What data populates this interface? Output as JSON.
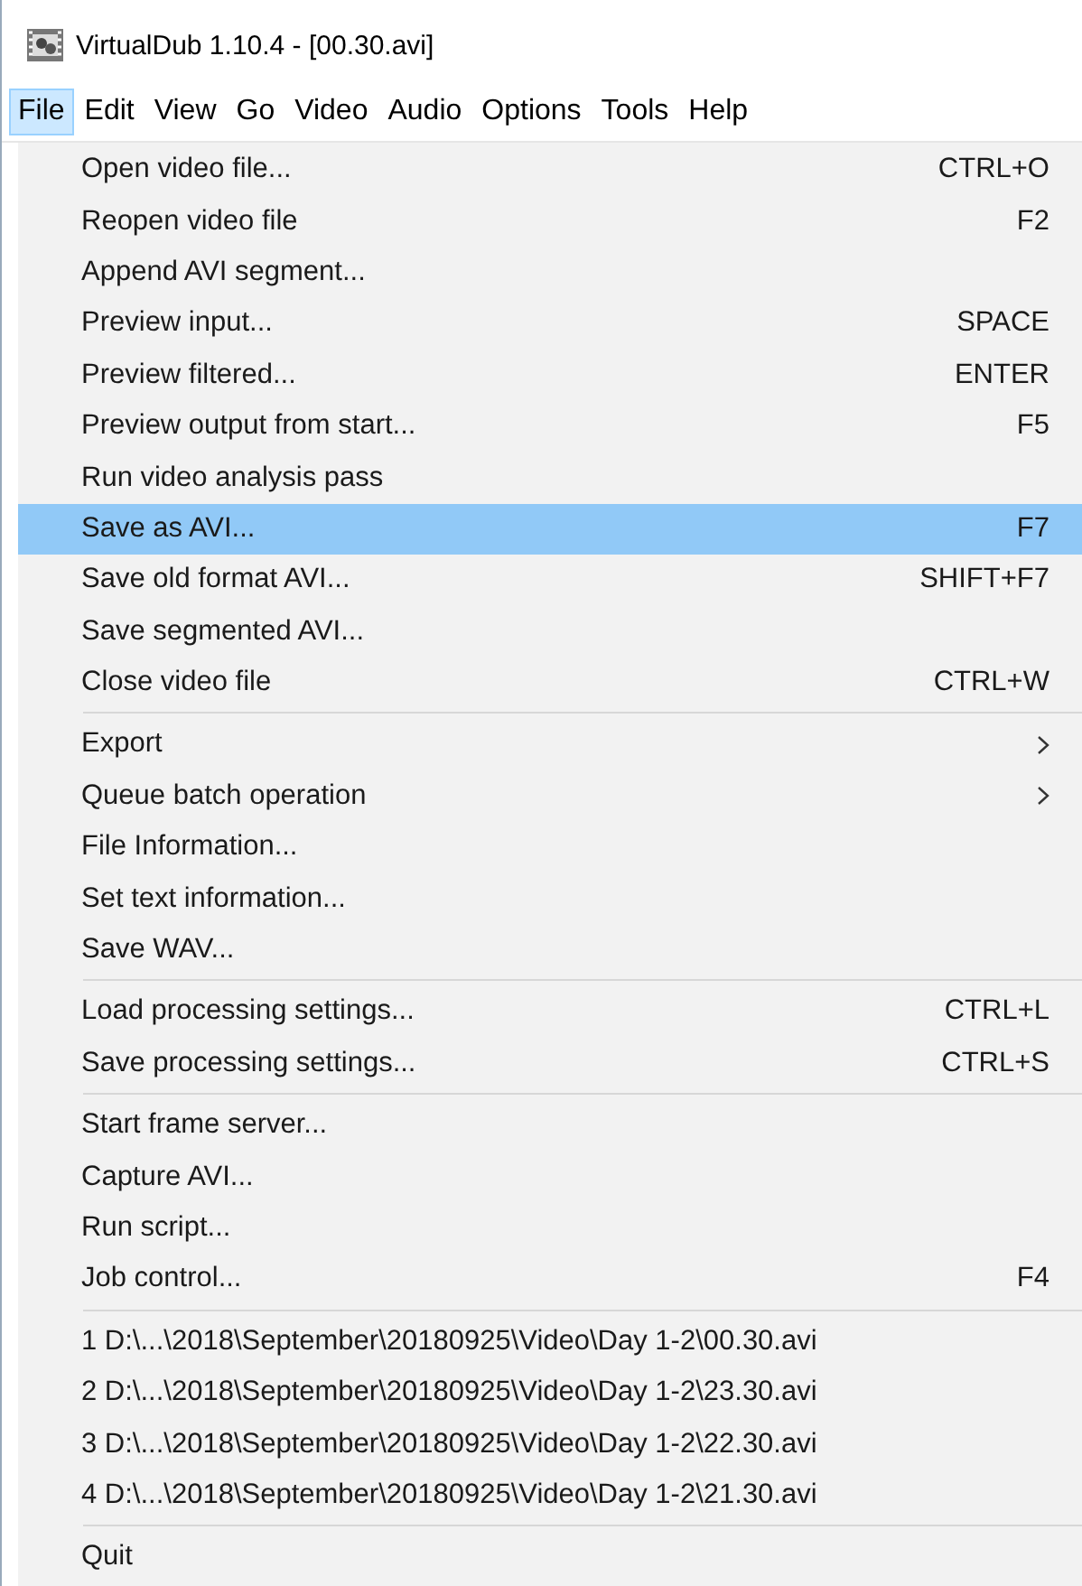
{
  "window": {
    "title": "VirtualDub 1.10.4 - [00.30.avi]"
  },
  "menu_bar": [
    {
      "label": "File",
      "selected": true
    },
    {
      "label": "Edit",
      "selected": false
    },
    {
      "label": "View",
      "selected": false
    },
    {
      "label": "Go",
      "selected": false
    },
    {
      "label": "Video",
      "selected": false
    },
    {
      "label": "Audio",
      "selected": false
    },
    {
      "label": "Options",
      "selected": false
    },
    {
      "label": "Tools",
      "selected": false
    },
    {
      "label": "Help",
      "selected": false
    }
  ],
  "file_menu": {
    "groups": [
      {
        "items": [
          {
            "kind": "command",
            "label": "Open video file...",
            "shortcut": "CTRL+O",
            "selected": false
          },
          {
            "kind": "command",
            "label": "Reopen video file",
            "shortcut": "F2",
            "selected": false
          },
          {
            "kind": "command",
            "label": "Append AVI segment...",
            "selected": false
          },
          {
            "kind": "command",
            "label": "Preview input...",
            "shortcut": "SPACE",
            "selected": false
          },
          {
            "kind": "command",
            "label": "Preview filtered...",
            "shortcut": "ENTER",
            "selected": false
          },
          {
            "kind": "command",
            "label": "Preview output from start...",
            "shortcut": "F5",
            "selected": false
          },
          {
            "kind": "command",
            "label": "Run video analysis pass",
            "selected": false
          },
          {
            "kind": "command",
            "label": "Save as AVI...",
            "shortcut": "F7",
            "selected": true
          },
          {
            "kind": "command",
            "label": "Save old format AVI...",
            "shortcut": "SHIFT+F7",
            "selected": false
          },
          {
            "kind": "command",
            "label": "Save segmented AVI...",
            "selected": false
          },
          {
            "kind": "command",
            "label": "Close video file",
            "shortcut": "CTRL+W",
            "selected": false
          }
        ]
      },
      {
        "items": [
          {
            "kind": "submenu",
            "label": "Export",
            "selected": false
          },
          {
            "kind": "submenu",
            "label": "Queue batch operation",
            "selected": false
          },
          {
            "kind": "command",
            "label": "File Information...",
            "selected": false
          },
          {
            "kind": "command",
            "label": "Set text information...",
            "selected": false
          },
          {
            "kind": "command",
            "label": "Save WAV...",
            "selected": false
          }
        ]
      },
      {
        "items": [
          {
            "kind": "command",
            "label": "Load processing settings...",
            "shortcut": "CTRL+L",
            "selected": false
          },
          {
            "kind": "command",
            "label": "Save processing settings...",
            "shortcut": "CTRL+S",
            "selected": false
          }
        ]
      },
      {
        "items": [
          {
            "kind": "command",
            "label": "Start frame server...",
            "selected": false
          },
          {
            "kind": "command",
            "label": "Capture AVI...",
            "selected": false
          },
          {
            "kind": "command",
            "label": "Run script...",
            "selected": false
          },
          {
            "kind": "command",
            "label": "Job control...",
            "shortcut": "F4",
            "selected": false
          }
        ]
      },
      {
        "items": [
          {
            "kind": "command",
            "label": "1 D:\\...\\2018\\September\\20180925\\Video\\Day 1-2\\00.30.avi",
            "selected": false
          },
          {
            "kind": "command",
            "label": "2 D:\\...\\2018\\September\\20180925\\Video\\Day 1-2\\23.30.avi",
            "selected": false
          },
          {
            "kind": "command",
            "label": "3 D:\\...\\2018\\September\\20180925\\Video\\Day 1-2\\22.30.avi",
            "selected": false
          },
          {
            "kind": "command",
            "label": "4 D:\\...\\2018\\September\\20180925\\Video\\Day 1-2\\21.30.avi",
            "selected": false
          }
        ]
      },
      {
        "items": [
          {
            "kind": "command",
            "label": "Quit",
            "selected": false
          }
        ]
      }
    ]
  }
}
